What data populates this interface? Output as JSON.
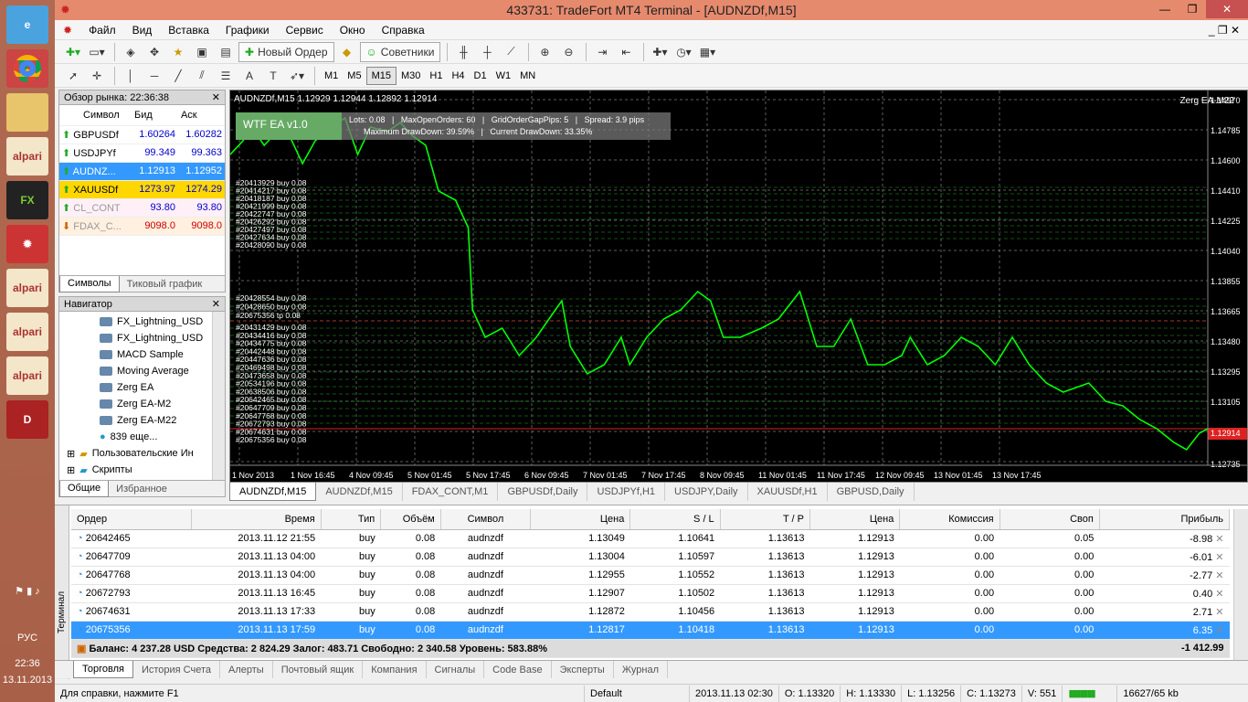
{
  "taskbar": {
    "icons": [
      "ie-icon",
      "chrome-icon",
      "explorer-icon",
      "alpari-icon",
      "fxpro-icon",
      "tradefort-icon",
      "alpari-icon",
      "alpari-icon",
      "alpari-icon",
      "dota-icon"
    ],
    "lang": "РУС",
    "time": "22:36",
    "date": "13.11.2013"
  },
  "window": {
    "title": "433731: TradeFort MT4 Terminal - [AUDNZDf,M15]"
  },
  "menu": [
    "Файл",
    "Вид",
    "Вставка",
    "Графики",
    "Сервис",
    "Окно",
    "Справка"
  ],
  "toolbar": {
    "new_order": "Новый Ордер",
    "advisors": "Советники"
  },
  "timeframes": [
    "M1",
    "M5",
    "M15",
    "M30",
    "H1",
    "H4",
    "D1",
    "W1",
    "MN"
  ],
  "active_tf": "M15",
  "market": {
    "title": "Обзор рынка: 22:36:38",
    "headers": [
      "Символ",
      "Бид",
      "Аск"
    ],
    "rows": [
      {
        "sym": "GBPUSDf",
        "bid": "1.60264",
        "ask": "1.60282",
        "style": "normal"
      },
      {
        "sym": "USDJPYf",
        "bid": "99.349",
        "ask": "99.363",
        "style": "normal"
      },
      {
        "sym": "AUDNZ...",
        "bid": "1.12913",
        "ask": "1.12952",
        "style": "selected"
      },
      {
        "sym": "XAUUSDf",
        "bid": "1273.97",
        "ask": "1274.29",
        "style": "yellow"
      },
      {
        "sym": "CL_CONT",
        "bid": "93.80",
        "ask": "93.80",
        "style": "grey"
      },
      {
        "sym": "FDAX_C...",
        "bid": "9098.0",
        "ask": "9098.0",
        "style": "grey"
      }
    ],
    "tabs": [
      "Символы",
      "Тиковый график"
    ]
  },
  "navigator": {
    "title": "Навигатор",
    "items": [
      "FX_Lightning_USD",
      "FX_Lightning_USD",
      "MACD Sample",
      "Moving Average",
      "Zerg EA",
      "Zerg EA-M2",
      "Zerg EA-M22",
      "839 еще..."
    ],
    "folders": [
      "Пользовательские Ин",
      "Скрипты"
    ],
    "tabs": [
      "Общие",
      "Избранное"
    ]
  },
  "chart": {
    "header": "AUDNZDf,M15  1.12929 1.12944 1.12892 1.12914",
    "ea_label": "Zerg EA-M22",
    "panel_title": "WTF EA v1.0",
    "panel_line1": "Lots: 0.08   |   MaxOpenOrders: 60   |   GridOrderGapPips: 5   |   Spread: 3.9 pips",
    "panel_line2": "Maximum DrawDown: 39.59%   |   Current DrawDown: 33.35%",
    "price_labels": [
      "1.14970",
      "1.14785",
      "1.14600",
      "1.14410",
      "1.14225",
      "1.14040",
      "1.13855",
      "1.13665",
      "1.13480",
      "1.13295",
      "1.13105",
      "1.12914",
      "1.12735"
    ],
    "time_labels": [
      "1 Nov 2013",
      "1 Nov 16:45",
      "4 Nov 09:45",
      "5 Nov 01:45",
      "5 Nov 17:45",
      "6 Nov 09:45",
      "7 Nov 01:45",
      "7 Nov 17:45",
      "8 Nov 09:45",
      "11 Nov 01:45",
      "11 Nov 17:45",
      "12 Nov 09:45",
      "13 Nov 01:45",
      "13 Nov 17:45"
    ],
    "order_labels": [
      "#20413929 buy 0.08",
      "#20414217 buy 0.08",
      "#20418187 buy 0.08",
      "#20421999 buy 0.08",
      "#20422747 buy 0.08",
      "#20426292 buy 0.08",
      "#20427497 buy 0.08",
      "#20427634 buy 0.08",
      "#20428090 buy 0.08",
      "#20428554 buy 0.08",
      "#20428650 buy 0.08",
      "#20675356 tp 0.08",
      "#20431429 buy 0.08",
      "#20434416 buy 0.08",
      "#20434775 buy 0.08",
      "#20442448 buy 0.08",
      "#20447636 buy 0.08",
      "#20469498 buy 0.08",
      "#20473658 buy 0.08",
      "#20534196 buy 0.08",
      "#20638506 buy 0.08",
      "#20642465 buy 0.08",
      "#20647709 buy 0.08",
      "#20647768 buy 0.08",
      "#20672793 buy 0.08",
      "#20674631 buy 0.08",
      "#20675356 buy 0.08"
    ]
  },
  "chart_tabs": [
    "AUDNZDf,M15",
    "AUDNZDf,M15",
    "FDAX_CONT,M1",
    "GBPUSDf,Daily",
    "USDJPYf,H1",
    "USDJPY,Daily",
    "XAUUSDf,H1",
    "GBPUSD,Daily"
  ],
  "terminal": {
    "side_label": "Терминал",
    "headers": [
      "Ордер",
      "Время",
      "Тип",
      "Объём",
      "Символ",
      "Цена",
      "S / L",
      "T / P",
      "Цена",
      "Комиссия",
      "Своп",
      "Прибыль"
    ],
    "rows": [
      [
        "20642465",
        "2013.11.12 21:55",
        "buy",
        "0.08",
        "audnzdf",
        "1.13049",
        "1.10641",
        "1.13613",
        "1.12913",
        "0.00",
        "0.05",
        "-8.98"
      ],
      [
        "20647709",
        "2013.11.13 04:00",
        "buy",
        "0.08",
        "audnzdf",
        "1.13004",
        "1.10597",
        "1.13613",
        "1.12913",
        "0.00",
        "0.00",
        "-6.01"
      ],
      [
        "20647768",
        "2013.11.13 04:00",
        "buy",
        "0.08",
        "audnzdf",
        "1.12955",
        "1.10552",
        "1.13613",
        "1.12913",
        "0.00",
        "0.00",
        "-2.77"
      ],
      [
        "20672793",
        "2013.11.13 16:45",
        "buy",
        "0.08",
        "audnzdf",
        "1.12907",
        "1.10502",
        "1.13613",
        "1.12913",
        "0.00",
        "0.00",
        "0.40"
      ],
      [
        "20674631",
        "2013.11.13 17:33",
        "buy",
        "0.08",
        "audnzdf",
        "1.12872",
        "1.10456",
        "1.13613",
        "1.12913",
        "0.00",
        "0.00",
        "2.71"
      ],
      [
        "20675356",
        "2013.11.13 17:59",
        "buy",
        "0.08",
        "audnzdf",
        "1.12817",
        "1.10418",
        "1.13613",
        "1.12913",
        "0.00",
        "0.00",
        "6.35"
      ]
    ],
    "balance": "Баланс: 4 237.28 USD  Средства: 2 824.29  Залог: 483.71  Свободно: 2 340.58  Уровень: 583.88%",
    "total": "-1 412.99",
    "tabs": [
      "Торговля",
      "История Счета",
      "Алерты",
      "Почтовый ящик",
      "Компания",
      "Сигналы",
      "Code Base",
      "Эксперты",
      "Журнал"
    ]
  },
  "status": {
    "help": "Для справки, нажмите F1",
    "profile": "Default",
    "datetime": "2013.11.13 02:30",
    "o": "O: 1.13320",
    "h": "H: 1.13330",
    "l": "L: 1.13256",
    "c": "C: 1.13273",
    "v": "V: 551",
    "traffic": "16627/65 kb"
  }
}
